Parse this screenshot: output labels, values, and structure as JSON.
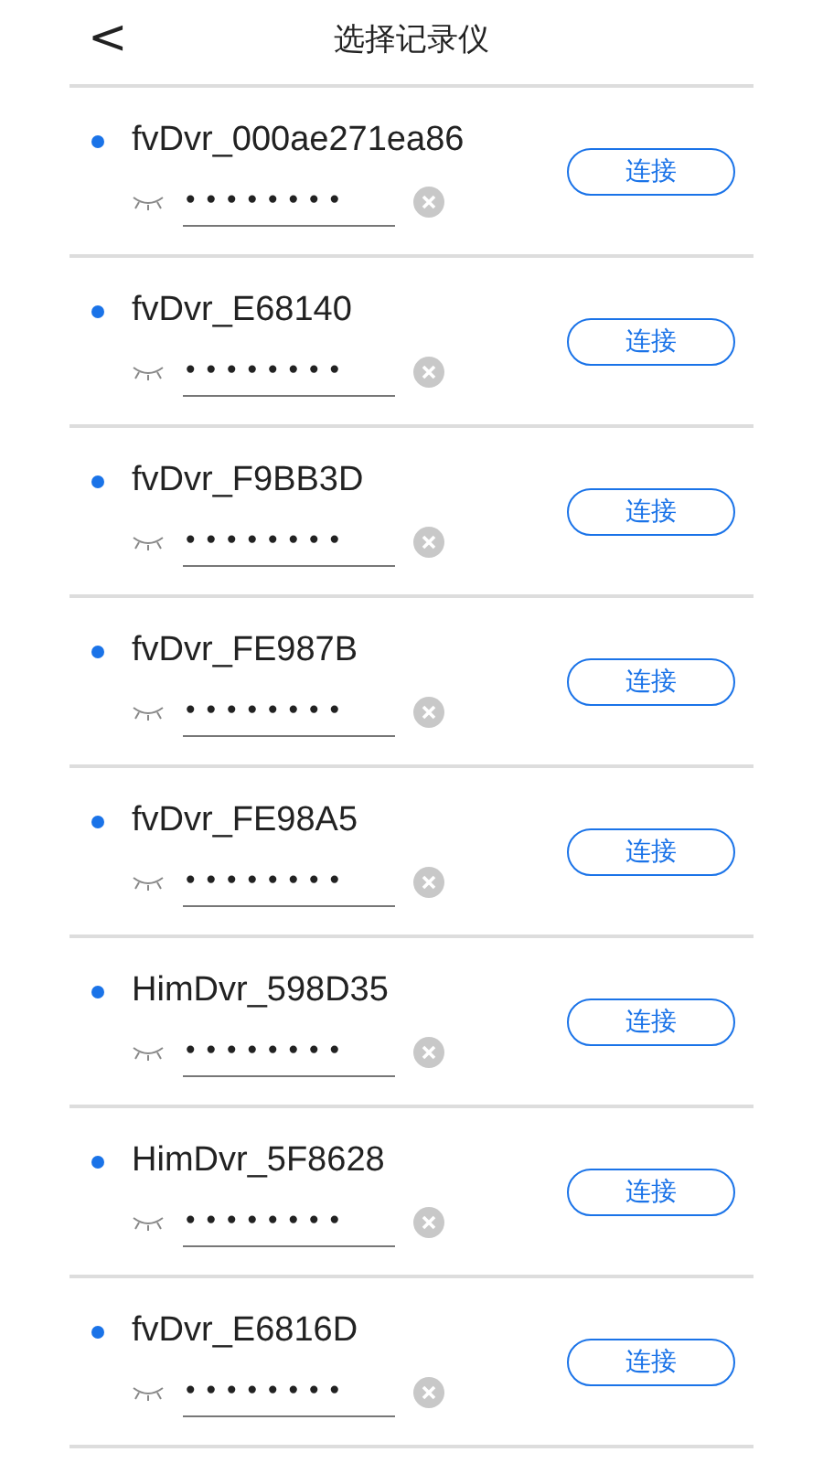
{
  "header": {
    "back": "<",
    "title": "选择记录仪"
  },
  "devices": [
    {
      "name": "fvDvr_000ae271ea86",
      "password": "••••••••",
      "button": "连接"
    },
    {
      "name": "fvDvr_E68140",
      "password": "••••••••",
      "button": "连接"
    },
    {
      "name": "fvDvr_F9BB3D",
      "password": "••••••••",
      "button": "连接"
    },
    {
      "name": "fvDvr_FE987B",
      "password": "••••••••",
      "button": "连接"
    },
    {
      "name": "fvDvr_FE98A5",
      "password": "••••••••",
      "button": "连接"
    },
    {
      "name": "HimDvr_598D35",
      "password": "••••••••",
      "button": "连接"
    },
    {
      "name": "HimDvr_5F8628",
      "password": "••••••••",
      "button": "连接"
    },
    {
      "name": "fvDvr_E6816D",
      "password": "••••••••",
      "button": "连接"
    }
  ]
}
